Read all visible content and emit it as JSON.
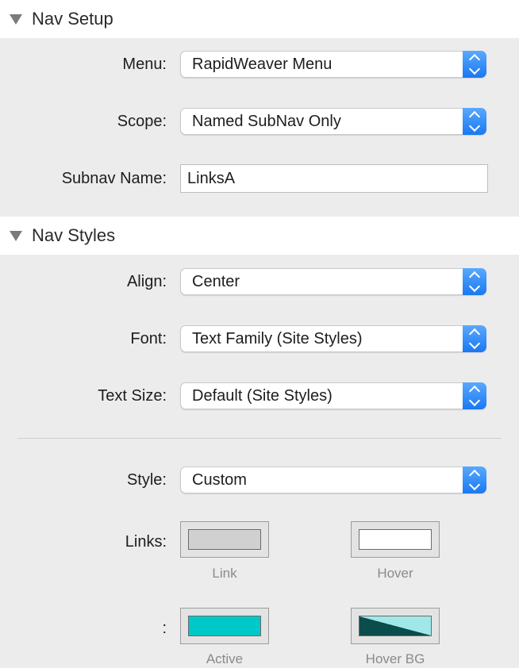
{
  "nav_setup": {
    "title": "Nav Setup",
    "menu_label": "Menu:",
    "menu_value": "RapidWeaver Menu",
    "scope_label": "Scope:",
    "scope_value": "Named SubNav Only",
    "subnav_label": "Subnav Name:",
    "subnav_value": "LinksA"
  },
  "nav_styles": {
    "title": "Nav Styles",
    "align_label": "Align:",
    "align_value": "Center",
    "font_label": "Font:",
    "font_value": "Text Family (Site Styles)",
    "textsize_label": "Text Size:",
    "textsize_value": "Default (Site Styles)",
    "style_label": "Style:",
    "style_value": "Custom",
    "links_label": "Links:",
    "row2_label": ":",
    "swatches": {
      "link": {
        "caption": "Link",
        "color": "#d0d0d0"
      },
      "hover": {
        "caption": "Hover",
        "color": "#ffffff"
      },
      "active": {
        "caption": "Active",
        "color": "#00c8c8"
      },
      "hover_bg": {
        "caption": "Hover BG",
        "color_a": "#0b4d4d",
        "color_b": "#a0e8e8"
      }
    }
  }
}
